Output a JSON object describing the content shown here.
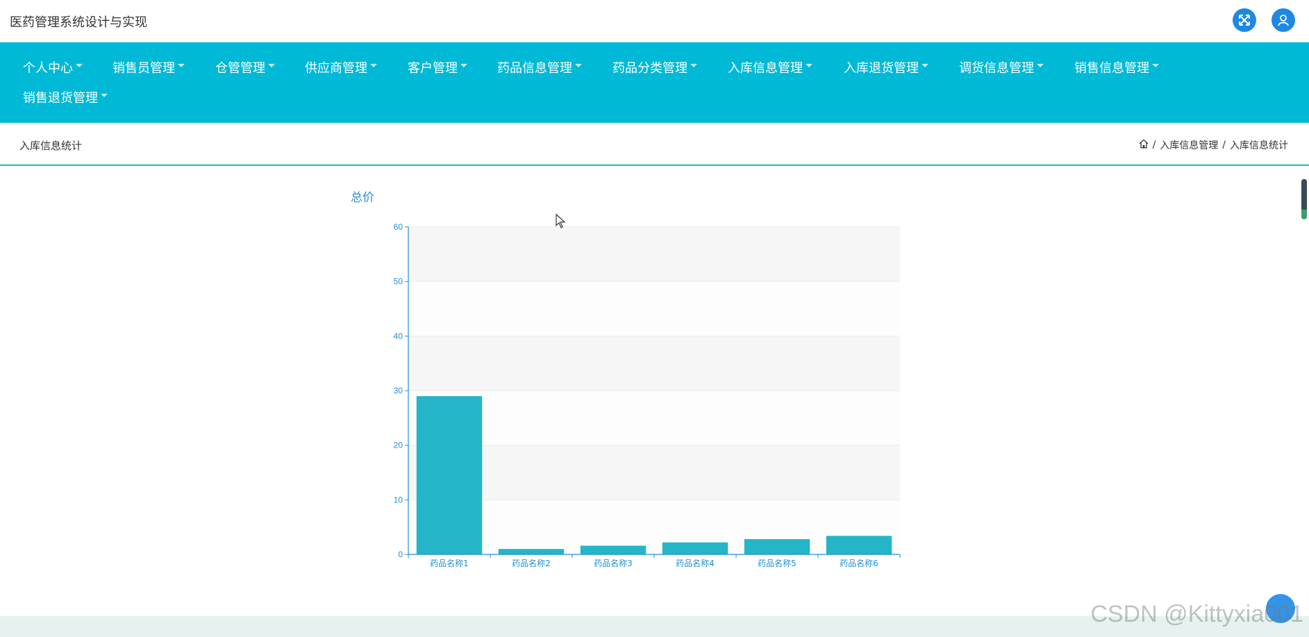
{
  "app": {
    "title": "医药管理系统设计与实现"
  },
  "header_icons": [
    "fullscreen-icon",
    "user-icon"
  ],
  "nav": {
    "items": [
      {
        "label": "个人中心"
      },
      {
        "label": "销售员管理"
      },
      {
        "label": "仓管管理"
      },
      {
        "label": "供应商管理"
      },
      {
        "label": "客户管理"
      },
      {
        "label": "药品信息管理"
      },
      {
        "label": "药品分类管理"
      },
      {
        "label": "入库信息管理"
      },
      {
        "label": "入库退货管理"
      },
      {
        "label": "调货信息管理"
      },
      {
        "label": "销售信息管理"
      },
      {
        "label": "销售退货管理"
      }
    ]
  },
  "page": {
    "title": "入库信息统计",
    "breadcrumb": [
      "入库信息管理",
      "入库信息统计"
    ]
  },
  "chart_data": {
    "type": "bar",
    "title": "总价",
    "categories": [
      "药品名称1",
      "药品名称2",
      "药品名称3",
      "药品名称4",
      "药品名称5",
      "药品名称6"
    ],
    "values": [
      29,
      1,
      1.6,
      2.2,
      2.8,
      3.4
    ],
    "ylim": [
      0,
      60
    ],
    "yticks": [
      0,
      10,
      20,
      30,
      40,
      50,
      60
    ],
    "grid": true,
    "bar_color": "#24b5c8",
    "axis_color": "#1f8fd6"
  },
  "colors": {
    "nav_bg": "#00b9d6",
    "accent": "#26b7c5",
    "button": "#1e88e5"
  },
  "watermark": "CSDN @Kittyxia001"
}
